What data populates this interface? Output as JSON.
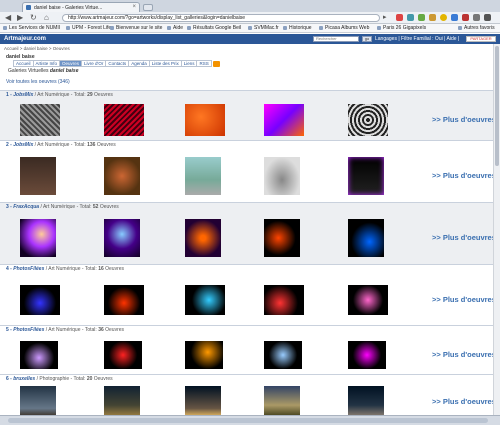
{
  "browser": {
    "tab_title": "daniel baise - Galeries Virtue...",
    "url": "http://www.artmajeur.com/?go=artworks/display_list_galleries&login=danielbaise"
  },
  "bookmarks": [
    "Les Services de NUMII",
    "UPM - Forest Life",
    "Bienvenue sur le site",
    "Aide",
    "Résultats Google Beil",
    "SVMMac.fr",
    "Historique",
    "Picasa Albums Web",
    "Paris 26 Gigapixels",
    "Autres favoris"
  ],
  "site": {
    "logo": "Artmajeur.com",
    "search_placeholder": "Rechercher",
    "go_label": "go",
    "lang_links": "Langages  |  Filtre Familial : Oui  |  Aide  |",
    "share_label": "PARTAGER"
  },
  "page": {
    "breadcrumb": "Accueil > daniel baise > Oeuvres",
    "owner": "daniel baise",
    "subnav": [
      "Accueil",
      "Artiste Info",
      "Oeuvres",
      "Livre d'Or",
      "Contacts",
      "Agenda",
      "Liste des Prix",
      "Liens",
      "RSS"
    ],
    "active_tab": "Oeuvres",
    "gallery_title_prefix": "Galeries Virtuelles",
    "gallery_title_name": "daniel baise",
    "see_all": "Voir toutes les oeuvres (346)",
    "plus_label": ">> Plus d'oeuvres"
  },
  "galleries": [
    {
      "num": "1 -",
      "name": "JobsMix",
      "category": "/ Art Numérique - Total:",
      "total": "29",
      "unit": "Oeuvres",
      "shaded": true
    },
    {
      "num": "2 -",
      "name": "JobsMix",
      "category": "/ Art Numérique - Total:",
      "total": "136",
      "unit": "Oeuvres",
      "shaded": false
    },
    {
      "num": "3 -",
      "name": "FraxAcqua",
      "category": "/ Art Numérique - Total:",
      "total": "52",
      "unit": "Oeuvres",
      "shaded": true
    },
    {
      "num": "4 -",
      "name": "PhotosFilées",
      "category": "/ Art Numérique - Total:",
      "total": "16",
      "unit": "Oeuvres",
      "shaded": false
    },
    {
      "num": "5 -",
      "name": "PhotosFilées",
      "category": "/ Art Numérique - Total:",
      "total": "36",
      "unit": "Oeuvres",
      "shaded": false
    },
    {
      "num": "6 -",
      "name": "bruxelles",
      "category": "/ Photographie - Total:",
      "total": "20",
      "unit": "Oeuvres",
      "shaded": false
    }
  ],
  "colors": {
    "site_blue": "#2b5797",
    "link_blue": "#3a6fb0"
  }
}
